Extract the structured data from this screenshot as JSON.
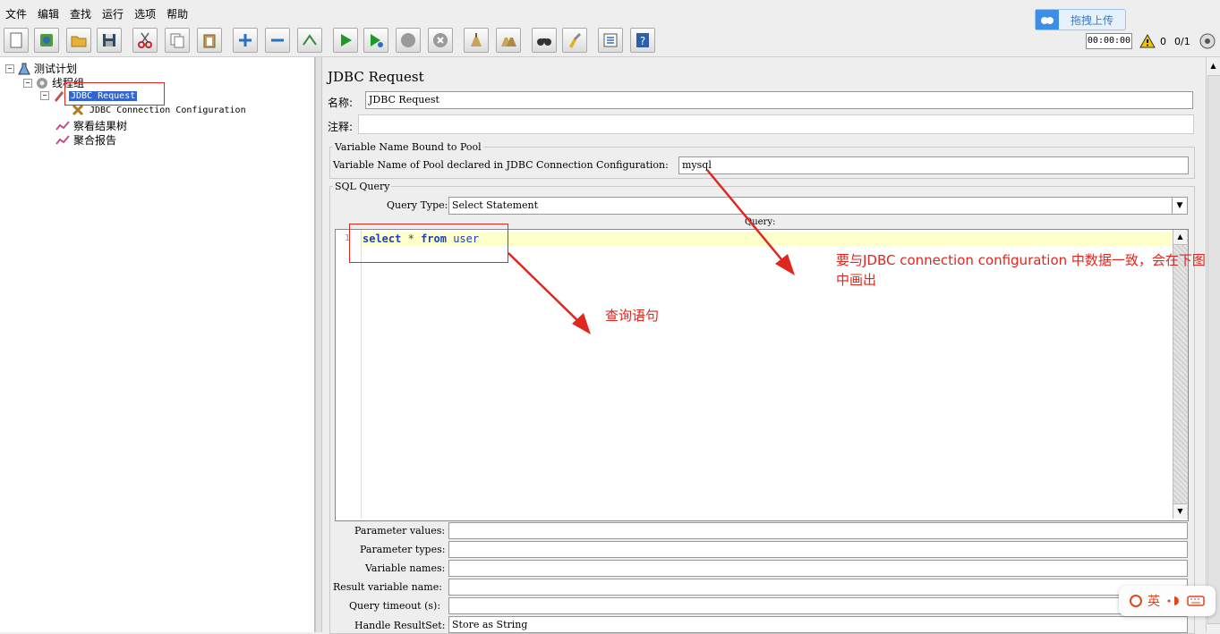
{
  "menu": [
    "文件",
    "编辑",
    "查找",
    "运行",
    "选项",
    "帮助"
  ],
  "toolbar_icons": [
    "new-icon",
    "templates-icon",
    "open-icon",
    "save-icon",
    "cut-icon",
    "copy-icon",
    "paste-icon",
    "expand-icon",
    "collapse-icon",
    "toggle-icon",
    "start-icon",
    "start-no-pause-icon",
    "stop-icon",
    "shutdown-icon",
    "clear-icon",
    "clear-all-icon",
    "search-icon",
    "reset-search-icon",
    "function-helper-icon",
    "help-icon"
  ],
  "upload": {
    "label": "拖拽上传"
  },
  "timer": "00:00:00",
  "status": {
    "errors": "0",
    "threads": "0/1"
  },
  "tree": {
    "plan": "测试计划",
    "thread_group": "线程组",
    "jdbc_request": "JDBC Request",
    "jdbc_config": "JDBC Connection Configuration",
    "results_tree": "察看结果树",
    "aggregate_report": "聚合报告"
  },
  "panel": {
    "title": "JDBC Request",
    "name_label": "名称:",
    "name_value": "JDBC Request",
    "comment_label": "注释:",
    "pool_group_title": "Variable Name Bound to Pool",
    "pool_label": "Variable Name of Pool declared in JDBC Connection Configuration:",
    "pool_value": "mysql",
    "sql_group_title": "SQL Query",
    "query_type_label": "Query Type:",
    "query_type_value": "Select Statement",
    "query_label": "Query:",
    "line_number": "1",
    "query_kw1": "select",
    "query_star": "*",
    "query_kw2": "from",
    "query_table": "user",
    "param_values_label": "Parameter values:",
    "param_types_label": "Parameter types:",
    "variable_names_label": "Variable names:",
    "result_variable_label": "Result variable name:",
    "query_timeout_label": "Query timeout (s):",
    "handle_resultset_label": "Handle ResultSet:",
    "handle_resultset_value": "Store as String"
  },
  "annotations": {
    "pool_note": "要与JDBC connection configuration 中数据一致，会在下图中画出",
    "query_note": "查询语句"
  },
  "ime": {
    "label": "英"
  },
  "colors": {
    "annotation": "#e0271f",
    "selection": "#3366cc",
    "highlight_line": "#ffffcc"
  }
}
